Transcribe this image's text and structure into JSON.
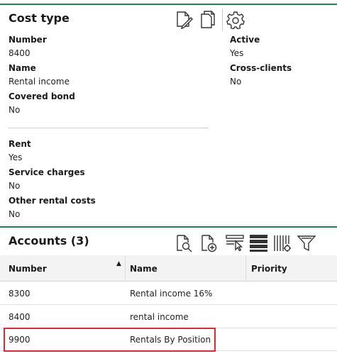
{
  "cost_type": {
    "title": "Cost type",
    "fields": {
      "number": {
        "label": "Number",
        "value": "8400"
      },
      "name": {
        "label": "Name",
        "value": "Rental income"
      },
      "covered_bond": {
        "label": "Covered bond",
        "value": "No"
      },
      "active": {
        "label": "Active",
        "value": "Yes"
      },
      "cross_clients": {
        "label": "Cross-clients",
        "value": "No"
      },
      "rent": {
        "label": "Rent",
        "value": "Yes"
      },
      "service_charges": {
        "label": "Service charges",
        "value": "No"
      },
      "other_rental_costs": {
        "label": "Other rental costs",
        "value": "No"
      }
    },
    "icons": [
      "edit-document-icon",
      "copy-document-icon",
      "gear-icon"
    ]
  },
  "accounts": {
    "title": "Accounts (3)",
    "icons": [
      "search-document-icon",
      "add-document-icon",
      "select-rows-icon",
      "rows-icon",
      "columns-settings-icon",
      "filter-icon"
    ],
    "columns": [
      "Number",
      "Name",
      "Priority"
    ],
    "sort": {
      "column": "Number",
      "direction": "ascending"
    },
    "rows": [
      {
        "number": "8300",
        "name": "Rental income 16%",
        "priority": ""
      },
      {
        "number": "8400",
        "name": "rental income",
        "priority": ""
      },
      {
        "number": "9900",
        "name": "Rentals By Position",
        "priority": ""
      }
    ],
    "selected_row": "9900"
  },
  "colors": {
    "accent_line": "#2e7d4f",
    "selection": "#d32f2f",
    "header_bg": "#f3f3f3"
  }
}
